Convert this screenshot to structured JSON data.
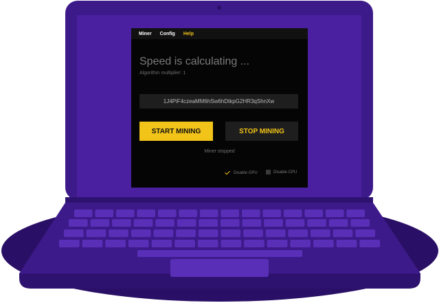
{
  "colors": {
    "laptop_body": "#3d1a8a",
    "laptop_light": "#4f24a8",
    "shadow": "#2a0f66",
    "screen_bg": "#050505",
    "accent": "#f2c318",
    "panel": "#1e1e1e"
  },
  "menu": {
    "items": [
      "Miner",
      "Config",
      "Help"
    ],
    "active": "Help"
  },
  "main": {
    "speed_text": "Speed is calculating ...",
    "algorithm_text": "Algorithm multiplier: 1",
    "wallet_address": "1J4PiF4czeaMM6hSw6hDtkpG2HR3qShnXw",
    "start_label": "START MINING",
    "stop_label": "STOP MINING",
    "status_text": "Miner stopped"
  },
  "options": {
    "gpu_label": "Disable GPU",
    "gpu_checked": true,
    "cpu_label": "Disable CPU",
    "cpu_checked": false
  }
}
